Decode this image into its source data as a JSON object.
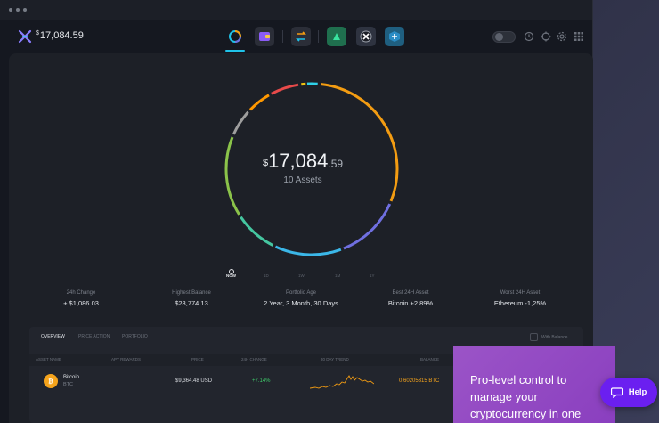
{
  "header": {
    "currency_symbol": "$",
    "balance": "17,084.59"
  },
  "nav": {
    "icons": [
      "portfolio-icon",
      "wallet-icon",
      "exchange-icon",
      "app-green-icon",
      "app-x-icon",
      "app-plus-icon"
    ]
  },
  "portfolio": {
    "currency_symbol": "$",
    "balance_main": "17,084",
    "balance_cents": ".59",
    "assets_count": "10 Assets",
    "ring_colors": [
      "#f39c12",
      "#6f6fe0",
      "#3bb7e8",
      "#45c6a0",
      "#8bc34a",
      "#9e9e9e",
      "#ff9800",
      "#e84a4a",
      "#f1c40f",
      "#2fd0e8"
    ]
  },
  "timeframes": [
    "NOW",
    "1D",
    "1W",
    "1M",
    "1Y",
    "ALL"
  ],
  "stats": [
    {
      "label": "24h Change",
      "value": "+ $1,086.03"
    },
    {
      "label": "Highest Balance",
      "value": "$28,774.13"
    },
    {
      "label": "Portfolio Age",
      "value": "2 Year, 3 Month, 30 Days"
    },
    {
      "label": "Best 24H Asset",
      "value": "Bitcoin +2.89%"
    },
    {
      "label": "Worst 24H Asset",
      "value": "Ethereum -1,25%"
    }
  ],
  "table": {
    "tabs": [
      "OVERVIEW",
      "PRICE ACTION",
      "PORTFOLIO"
    ],
    "with_balance_label": "With Balance",
    "headers": [
      "ASSET NAME",
      "APY REWARDS",
      "PRICE",
      "24H CHANGE",
      "30 DAY TREND",
      "BALANCE"
    ],
    "rows": [
      {
        "name": "Bitcoin",
        "symbol": "BTC",
        "price": "$9,364.48 USD",
        "change": "+7.14%",
        "balance": "0.60205315 BTC"
      }
    ],
    "colors": {
      "positive": "#3ec96a",
      "balance": "#f6a41c"
    }
  },
  "promo": {
    "text": "Pro-level control to manage your cryptocurrency in one beautiful application..."
  },
  "help": {
    "label": "Help"
  }
}
